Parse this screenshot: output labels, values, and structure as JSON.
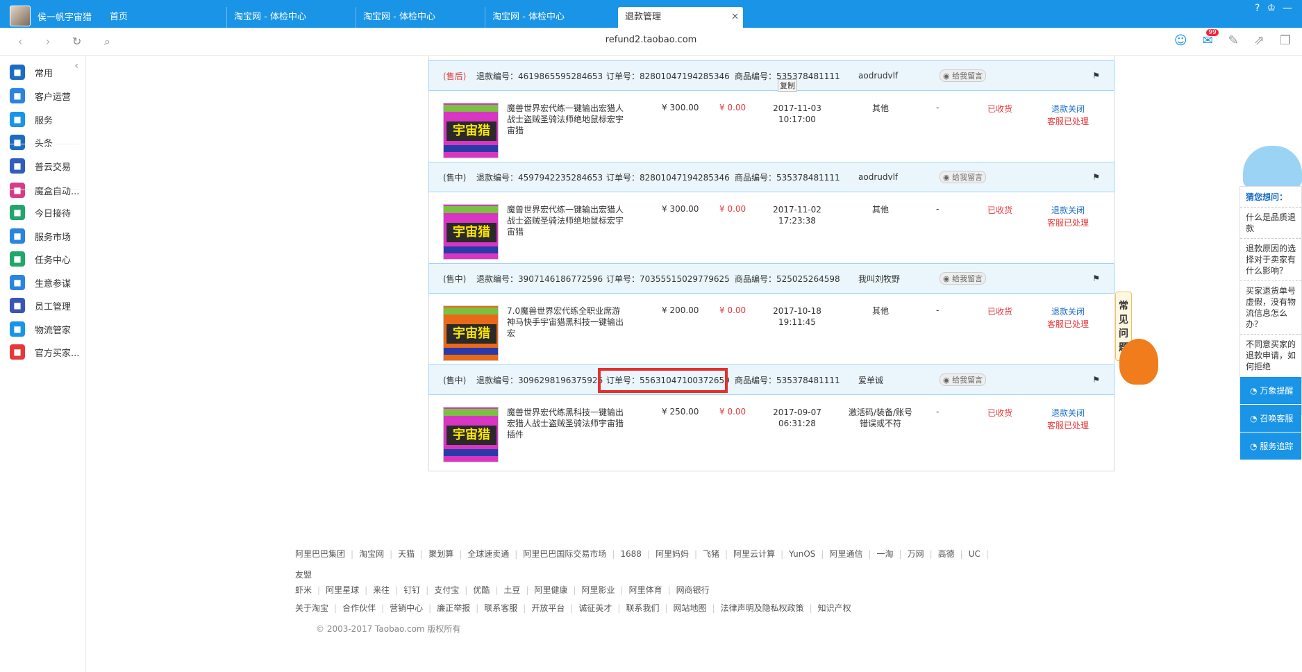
{
  "browser": {
    "profile_name": "侯一帆宇宙猎",
    "tabs": [
      {
        "label": "首页"
      },
      {
        "label": "淘宝网 - 体检中心"
      },
      {
        "label": "淘宝网 - 体检中心"
      },
      {
        "label": "淘宝网 - 体检中心"
      },
      {
        "label": "退款管理",
        "active": true
      }
    ],
    "url": "refund2.taobao.com",
    "mail_badge": "99"
  },
  "sidebar": {
    "items": [
      {
        "label": "常用",
        "icon": "list-icon",
        "color": "#1a6dc3"
      },
      {
        "label": "客户运营",
        "icon": "star-people-icon",
        "color": "#2a84e0"
      },
      {
        "label": "服务",
        "icon": "bag-icon",
        "color": "#1a94e6"
      },
      {
        "label": "头条",
        "icon": "news-icon",
        "color": "#1a6dc3"
      },
      {
        "label": "普云交易",
        "icon": "cloud-trade-icon",
        "color": "#2f5fb8"
      },
      {
        "label": "魔盒自动...",
        "icon": "magic-box-icon",
        "color": "#d43d8a"
      },
      {
        "label": "今日接待",
        "icon": "reception-icon",
        "color": "#23a66b"
      },
      {
        "label": "服务市场",
        "icon": "market-icon",
        "color": "#2a84e0"
      },
      {
        "label": "任务中心",
        "icon": "task-icon",
        "color": "#23a66b"
      },
      {
        "label": "生意参谋",
        "icon": "advisor-icon",
        "color": "#2a84e0"
      },
      {
        "label": "员工管理",
        "icon": "staff-icon",
        "color": "#3a55b8"
      },
      {
        "label": "物流管家",
        "icon": "logistics-icon",
        "color": "#1a94e6"
      },
      {
        "label": "官方买家...",
        "icon": "buyer-icon",
        "color": "#e4393c"
      }
    ]
  },
  "orders": [
    {
      "type": "(售后)",
      "type_red": true,
      "refund_no": "退款编号：4619865595284653",
      "order_no": "订单号：82801047194285346",
      "item_no": "商品编号：535378481111",
      "buyer": "aodrudvlf",
      "msg_label": "给我留言",
      "copy_tip": "复制",
      "title": "魔兽世界宏代练一键输出宏猎人战士盗贼圣骑法师绝地鼠标宏宇宙猎",
      "price": "¥ 300.00",
      "refund_amount": "¥ 0.00",
      "date": "2017-11-03",
      "time": "10:17:00",
      "reason": "其他",
      "dash": "-",
      "goods_status": "已收货",
      "status1": "退款关闭",
      "status2": "客服已处理"
    },
    {
      "type": "(售中)",
      "refund_no": "退款编号：4597942235284653",
      "order_no": "订单号：82801047194285346",
      "item_no": "商品编号：535378481111",
      "buyer": "aodrudvlf",
      "msg_label": "给我留言",
      "title": "魔兽世界宏代练一键输出宏猎人战士盗贼圣骑法师绝地鼠标宏宇宙猎",
      "price": "¥ 300.00",
      "refund_amount": "¥ 0.00",
      "date": "2017-11-02",
      "time": "17:23:38",
      "reason": "其他",
      "dash": "-",
      "goods_status": "已收货",
      "status1": "退款关闭",
      "status2": "客服已处理"
    },
    {
      "type": "(售中)",
      "refund_no": "退款编号：3907146186772596",
      "order_no": "订单号：70355515029779625",
      "item_no": "商品编号：525025264598",
      "buyer": "我叫刘牧野",
      "msg_label": "给我留言",
      "title": "7.0魔兽世界宏代练全职业席游神马快手宇宙猎黑科技一键输出宏",
      "price": "¥ 200.00",
      "refund_amount": "¥ 0.00",
      "date": "2017-10-18",
      "time": "19:11:45",
      "reason": "其他",
      "dash": "-",
      "goods_status": "已收货",
      "status1": "退款关闭",
      "status2": "客服已处理"
    },
    {
      "type": "(售中)",
      "refund_no": "退款编号：3096298196375926",
      "order_no": "订单号：55631047100372659",
      "item_no": "商品编号：535378481111",
      "buyer": "爱单诚",
      "msg_label": "给我留言",
      "title": "魔兽世界宏代练黑科技一键输出宏猎人战士盗贼圣骑法师宇宙猎插件",
      "price": "¥ 250.00",
      "refund_amount": "¥ 0.00",
      "date": "2017-09-07",
      "time": "06:31:28",
      "reason": "激活码/装备/账号错误或不符",
      "dash": "-",
      "goods_status": "已收货",
      "status1": "退款关闭",
      "status2": "客服已处理"
    }
  ],
  "thumb_label": "宇宙猎",
  "footer": {
    "row1": [
      "阿里巴巴集团",
      "淘宝网",
      "天猫",
      "聚划算",
      "全球速卖通",
      "阿里巴巴国际交易市场",
      "1688",
      "阿里妈妈",
      "飞猪",
      "阿里云计算",
      "YunOS",
      "阿里通信",
      "一淘",
      "万网",
      "高德",
      "UC",
      "友盟"
    ],
    "row2": [
      "虾米",
      "阿里星球",
      "来往",
      "钉钉",
      "支付宝",
      "优酷",
      "土豆",
      "阿里健康",
      "阿里影业",
      "阿里体育",
      "网商银行"
    ],
    "row3": [
      "关于淘宝",
      "合作伙伴",
      "营销中心",
      "廉正举报",
      "联系客服",
      "开放平台",
      "诚征英才",
      "联系我们",
      "网站地图",
      "法律声明及隐私权政策",
      "知识产权"
    ],
    "copyright": "© 2003-2017 Taobao.com 版权所有"
  },
  "faq": {
    "tab_label": "常见问题",
    "title": "猜您想问：",
    "questions": [
      "什么是品质退款",
      "退款原因的选择对于卖家有什么影响？",
      "买家退货单号虚假，没有物流信息怎么办？",
      "不同意买家的退款申请，如何拒绝"
    ],
    "actions": [
      "万象提醒",
      "召唤客服",
      "服务追踪"
    ]
  }
}
